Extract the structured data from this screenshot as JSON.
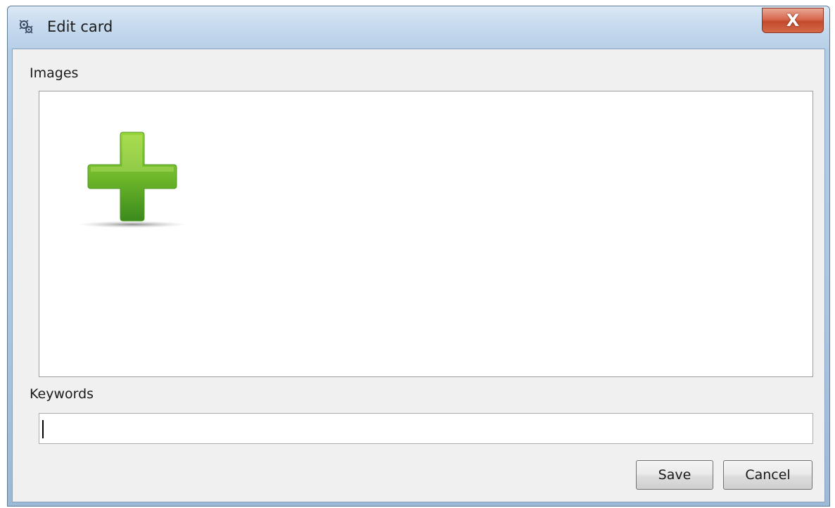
{
  "window": {
    "title": "Edit card",
    "close_label": "X"
  },
  "images": {
    "label": "Images"
  },
  "keywords": {
    "label": "Keywords",
    "value": ""
  },
  "buttons": {
    "save_label": "Save",
    "cancel_label": "Cancel"
  },
  "colors": {
    "add_icon_light": "#8fce2e",
    "add_icon_dark": "#3f8f1f",
    "close_red": "#c9482b"
  },
  "icons": {
    "title": "app-icon",
    "add": "add-plus-icon",
    "close": "close-icon"
  }
}
